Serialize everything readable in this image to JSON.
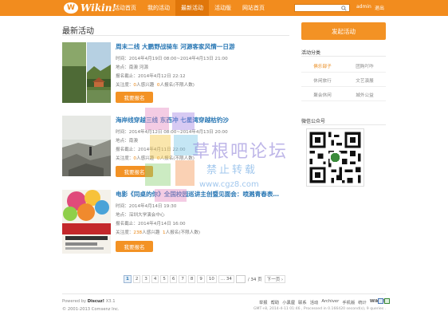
{
  "header": {
    "logo_mark": "W",
    "logo_text": "Wikin!",
    "nav": [
      "活动首页",
      "我的活动",
      "最新活动",
      "活动版",
      "网站首页"
    ],
    "active_nav": 2,
    "user": "admin",
    "logout": "退出"
  },
  "main": {
    "title": "最新活动",
    "signup_label": "我要报名",
    "posts": [
      {
        "title": "周末二线 大鹏野战骑车 河源客家风情一日游",
        "time": "时间：2014年4月19日 08:00~2014年4月13日 21:00",
        "place": "地点：南澳 河源",
        "deadline": "报名截止：2014年4月12日 22:12",
        "follow_pre": "关注度：",
        "follow_count": "0",
        "follow_mid": "人感兴趣",
        "signup_count": "0",
        "signup_post": "人报名(不限人数)"
      },
      {
        "title": "海岸线穿越三线 东西冲 七星湾穿越枯钓沙",
        "time": "时间：2014年4月12日 08:00~2014年4月13日 20:00",
        "place": "地点：南澳",
        "deadline": "报名截止：2014年4月11日 22:00",
        "follow_pre": "关注度：",
        "follow_count": "0",
        "follow_mid": "人感兴趣",
        "signup_count": "0",
        "signup_post": "人报名(不限人数)"
      },
      {
        "title": "电影《同桌的你》全国校园巡讲主创暨见面会：喷溅青春表…",
        "time": "时间：2014年4月14日 19:30",
        "place": "地点：深圳大学演会中心",
        "deadline": "报名截止：2014年4月14日 16:00",
        "follow_pre": "关注度：",
        "follow_count": "238",
        "follow_mid": "人感兴趣",
        "signup_count": "1",
        "signup_post": "人报名(不限人数)"
      }
    ]
  },
  "sidebar": {
    "launch_label": "发起活动",
    "categories_title": "活动分类",
    "categories": [
      "俱乐部子",
      "团购吖咋",
      "休闲旅行",
      "文艺演展",
      "聚会休闲",
      "城外公益"
    ],
    "selected_category": 0,
    "wechat_title": "微信公众号"
  },
  "pager": {
    "pages": [
      "1",
      "2",
      "3",
      "4",
      "5",
      "6",
      "7",
      "8",
      "9",
      "10",
      "... 34"
    ],
    "current": "1",
    "total": "/ 34 页",
    "next": "下一页 ›"
  },
  "footer": {
    "powered_pre": "Powered by ",
    "powered_name": "Discuz!",
    "powered_ver": " X3.1",
    "copyright": "© 2001-2013 Comsenz Inc.",
    "links": [
      "举报",
      "帮助",
      "小黑屋",
      "联系",
      "活动",
      "Archiver",
      "手机版",
      "统计",
      "Wikin!"
    ],
    "stats": "GMT+8, 2014-4-11 01:46 , Processed in 0.166420 second(s), 9 queries ."
  },
  "watermark": {
    "line1": "草根吧论坛",
    "line2": "禁止转载",
    "line3": "www.cgz8.com"
  },
  "colors": {
    "brand": "#f28c1e",
    "link": "#2a78b5",
    "highlight": "#e8830f"
  }
}
